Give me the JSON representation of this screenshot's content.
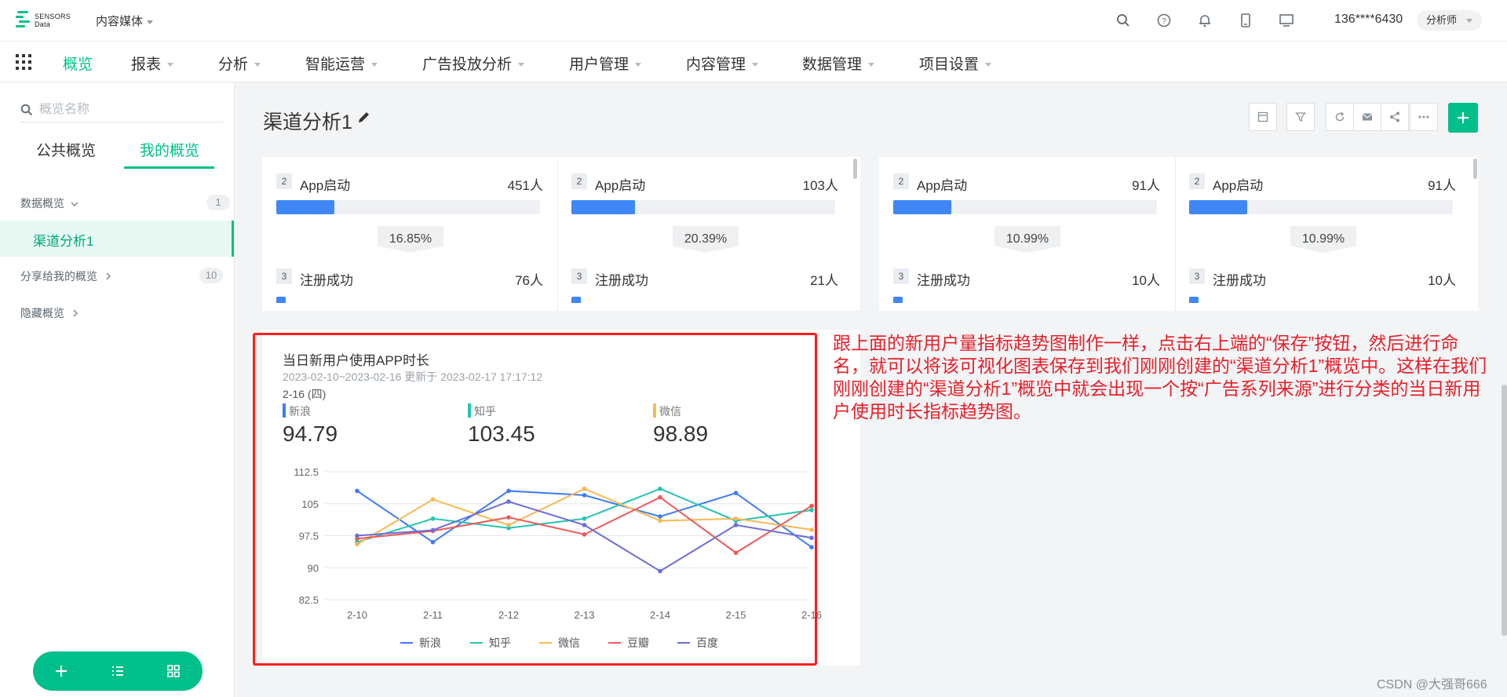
{
  "brand": {
    "name_line1": "SENSORS",
    "name_line2": "Data",
    "project": "内容媒体"
  },
  "top": {
    "user": "136****6430",
    "role": "分析师",
    "icons": [
      "search-icon",
      "help-icon",
      "bell-icon",
      "mobile-icon",
      "monitor-icon"
    ]
  },
  "nav": {
    "items": [
      "概览",
      "报表",
      "分析",
      "智能运营",
      "广告投放分析",
      "用户管理",
      "内容管理",
      "数据管理",
      "项目设置"
    ],
    "active": "概览"
  },
  "sidebar": {
    "search_placeholder": "概览名称",
    "tabs": [
      "公共概览",
      "我的概览"
    ],
    "groups": [
      {
        "label": "数据概览",
        "count": "1"
      },
      {
        "label": "分享给我的概览",
        "count": "10"
      },
      {
        "label": "隐藏概览",
        "count": ""
      }
    ],
    "active_item": "渠道分析1"
  },
  "dashboard": {
    "title": "渠道分析1"
  },
  "funnels": [
    {
      "steps": [
        {
          "num": "2",
          "label": "App启动",
          "value": "451人",
          "fill": 0.22
        },
        {
          "num": "3",
          "label": "注册成功",
          "value": "76人"
        }
      ],
      "rate": "16.85%"
    },
    {
      "steps": [
        {
          "num": "2",
          "label": "App启动",
          "value": "103人",
          "fill": 0.24
        },
        {
          "num": "3",
          "label": "注册成功",
          "value": "21人"
        }
      ],
      "rate": "20.39%"
    },
    {
      "steps": [
        {
          "num": "2",
          "label": "App启动",
          "value": "91人",
          "fill": 0.22
        },
        {
          "num": "3",
          "label": "注册成功",
          "value": "10人"
        }
      ],
      "rate": "10.99%"
    },
    {
      "steps": [
        {
          "num": "2",
          "label": "App启动",
          "value": "91人",
          "fill": 0.22
        },
        {
          "num": "3",
          "label": "注册成功",
          "value": "10人"
        }
      ],
      "rate": "10.99%"
    }
  ],
  "trend": {
    "title": "当日新用户使用APP时长",
    "subtitle": "2023-02-10~2023-02-16 更新于 2023-02-17 17:17:12",
    "date_label": "2-16 (四)",
    "kpis": [
      {
        "name": "新浪",
        "value": "94.79",
        "color": "#3f7cf5"
      },
      {
        "name": "知乎",
        "value": "103.45",
        "color": "#26c5b0"
      },
      {
        "name": "微信",
        "value": "98.89",
        "color": "#f7b955"
      }
    ]
  },
  "chart_data": {
    "type": "line",
    "title": "当日新用户使用APP时长",
    "categories": [
      "2-10",
      "2-11",
      "2-12",
      "2-13",
      "2-14",
      "2-15",
      "2-16"
    ],
    "ylim": [
      82.5,
      112.5
    ],
    "yticks": [
      "112.5",
      "105",
      "97.5",
      "90",
      "82.5"
    ],
    "grid": true,
    "legend": "bottom",
    "series": [
      {
        "name": "新浪",
        "color": "#3f7cf5",
        "values": [
          108.0,
          96.0,
          108.0,
          107.0,
          102.0,
          107.5,
          94.8
        ]
      },
      {
        "name": "知乎",
        "color": "#26c5b0",
        "values": [
          96.0,
          101.5,
          99.3,
          101.5,
          108.5,
          101.0,
          103.5
        ]
      },
      {
        "name": "微信",
        "color": "#f7b955",
        "values": [
          95.5,
          106.0,
          100.0,
          108.5,
          101.0,
          101.5,
          98.9
        ]
      },
      {
        "name": "豆瓣",
        "color": "#ee5a5a",
        "values": [
          96.8,
          98.6,
          101.8,
          97.8,
          106.5,
          93.5,
          104.5
        ]
      },
      {
        "name": "百度",
        "color": "#6b6ed8",
        "values": [
          97.5,
          98.8,
          105.5,
          100.0,
          89.2,
          100.0,
          97.0
        ]
      }
    ]
  },
  "annotation": "跟上面的新用户量指标趋势图制作一样，点击右上端的“保存”按钮，然后进行命名，就可以将该可视化图表保存到我们刚刚创建的“渠道分析1”概览中。这样在我们刚刚创建的“渠道分析1”概览中就会出现一个按“广告系列来源”进行分类的当日新用户使用时长指标趋势图。",
  "watermark": "CSDN @大强哥666"
}
